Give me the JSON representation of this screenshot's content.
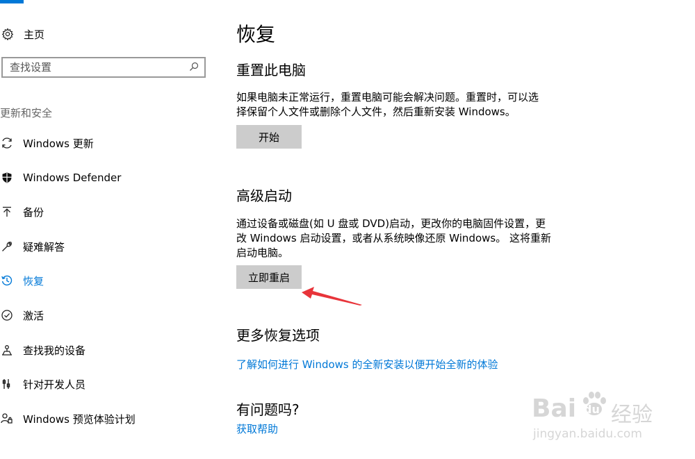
{
  "sidebar": {
    "home_label": "主页",
    "search": {
      "placeholder": "查找设置",
      "value": ""
    },
    "section_label": "更新和安全",
    "items": [
      {
        "label": "Windows 更新",
        "icon": "refresh-icon"
      },
      {
        "label": "Windows Defender",
        "icon": "shield-icon"
      },
      {
        "label": "备份",
        "icon": "backup-arrow-icon"
      },
      {
        "label": "疑难解答",
        "icon": "wrench-icon"
      },
      {
        "label": "恢复",
        "icon": "history-icon",
        "active": true
      },
      {
        "label": "激活",
        "icon": "check-circle-icon"
      },
      {
        "label": "查找我的设备",
        "icon": "find-device-icon"
      },
      {
        "label": "针对开发人员",
        "icon": "developer-tools-icon"
      },
      {
        "label": "Windows 预览体验计划",
        "icon": "insider-person-icon"
      }
    ]
  },
  "main": {
    "title": "恢复",
    "reset": {
      "heading": "重置此电脑",
      "line1": "如果电脑未正常运行，重置电脑可能会解决问题。重置时，可以选",
      "line2": "择保留个人文件或删除个人文件，然后重新安装 Windows。",
      "button_label": "开始"
    },
    "advanced": {
      "heading": "高级启动",
      "line1": "通过设备或磁盘(如 U 盘或 DVD)启动，更改你的电脑固件设置，更",
      "line2": "改 Windows 启动设置，或者从系统映像还原 Windows。 这将重新",
      "line3": "启动电脑。",
      "button_label": "立即重启"
    },
    "more": {
      "heading": "更多恢复选项",
      "link": "了解如何进行 Windows 的全新安装以便开始全新的体验"
    },
    "help": {
      "heading": "有问题吗?",
      "link": "获取帮助"
    }
  },
  "watermark": {
    "brand_en": "Bai",
    "brand_en2": "du",
    "brand_cn": "经验",
    "url": "jingyan.baidu.com"
  },
  "colors": {
    "accent": "#0078d7",
    "button": "#cccccc",
    "annotation_arrow": "#e8343a"
  }
}
